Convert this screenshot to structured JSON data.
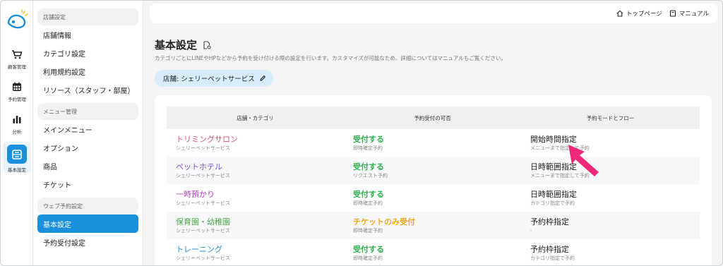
{
  "rail": {
    "items": [
      {
        "label": "顧客管理",
        "icon": "cart-icon"
      },
      {
        "label": "予約管理",
        "icon": "calendar-icon"
      },
      {
        "label": "分析",
        "icon": "bar-chart-icon"
      },
      {
        "label": "基本設定",
        "icon": "settings-box-icon",
        "active": true
      }
    ]
  },
  "sidebar": {
    "groups": [
      {
        "title": "店舗設定",
        "items": [
          "店舗情報",
          "カテゴリ設定",
          "利用規約設定",
          "リソース（スタッフ・部屋）"
        ]
      },
      {
        "title": "メニュー管理",
        "items": [
          "メインメニュー",
          "オプション",
          "商品",
          "チケット"
        ]
      },
      {
        "title": "ウェブ予約設定",
        "items": [
          "基本設定",
          "予約受付設定"
        ]
      }
    ]
  },
  "topbar": {
    "home_label": "トップページ",
    "manual_label": "マニュアル"
  },
  "page": {
    "title": "基本設定",
    "description": "カテゴリごとにLINEやHPなどから予約を受け付ける際の設定を行います。カスタマイズが可能なため、詳細についてはマニュアルもご覧ください。",
    "shop_label": "店舗: シェリーペットサービス"
  },
  "table": {
    "headers": [
      "店舗・カテゴリ",
      "予約受付の可否",
      "予約モードとフロー"
    ],
    "rows": [
      {
        "category": "トリミングサロン",
        "category_color": "#e0506a",
        "shop": "シェリーペットサービス",
        "status": "受付する",
        "status_color": "#2bb24c",
        "status_sub": "即時確定予約",
        "mode": "開始時間指定",
        "mode_sub": "メニューまで指定して予約"
      },
      {
        "category": "ペットホテル",
        "category_color": "#7b4fc9",
        "shop": "シェリーペットサービス",
        "status": "受付する",
        "status_color": "#2bb24c",
        "status_sub": "リクエスト予約",
        "mode": "日時範囲指定",
        "mode_sub": "メニューまで指定して予約"
      },
      {
        "category": "一時預かり",
        "category_color": "#b944c8",
        "shop": "シェリーペットサービス",
        "status": "受付する",
        "status_color": "#2bb24c",
        "status_sub": "即時確定予約",
        "mode": "日時範囲指定",
        "mode_sub": "カテゴリ指定で予約"
      },
      {
        "category": "保育園・幼稚園",
        "category_color": "#4ea64a",
        "shop": "シェリーペットサービス",
        "status": "チケットのみ受付",
        "status_color": "#f0a81e",
        "status_sub": "即時確定予約",
        "mode": "予約枠指定",
        "mode_sub": "-"
      },
      {
        "category": "トレーニング",
        "category_color": "#1e90e0",
        "shop": "シェリーペットサービス",
        "status": "受付する",
        "status_color": "#2bb24c",
        "status_sub": "即時確定予約",
        "mode": "予約枠指定",
        "mode_sub": "カテゴリ指定で予約"
      }
    ]
  },
  "colors": {
    "accent": "#1a8fdc",
    "pointer": "#f0287a"
  }
}
